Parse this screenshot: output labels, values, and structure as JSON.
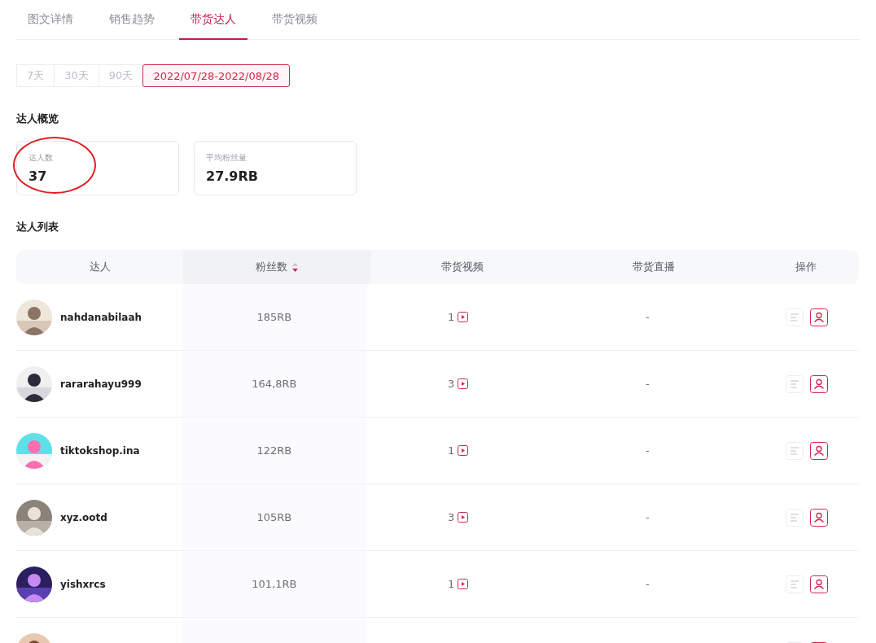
{
  "tabs": [
    {
      "label": "图文详情",
      "selected": false
    },
    {
      "label": "销售趋势",
      "selected": false
    },
    {
      "label": "带货达人",
      "selected": true
    },
    {
      "label": "带货视频",
      "selected": false
    }
  ],
  "date_ranges": [
    {
      "label": "7天",
      "selected": false
    },
    {
      "label": "30天",
      "selected": false
    },
    {
      "label": "90天",
      "selected": false
    },
    {
      "label": "2022/07/28-2022/08/28",
      "selected": true
    }
  ],
  "overview": {
    "title": "达人概览",
    "cards": [
      {
        "label": "达人数",
        "value": "37",
        "circled": true
      },
      {
        "label": "平均粉丝量",
        "value": "27.9RB",
        "circled": false
      }
    ]
  },
  "list": {
    "title": "达人列表",
    "columns": [
      {
        "label": "达人",
        "sorted": false
      },
      {
        "label": "粉丝数",
        "sorted": true
      },
      {
        "label": "带货视频",
        "sorted": false
      },
      {
        "label": "带货直播",
        "sorted": false
      },
      {
        "label": "操作",
        "sorted": false
      }
    ],
    "rows": [
      {
        "kind": "creator",
        "name": "nahdanabilaah",
        "fans": "185RB",
        "videos": "1",
        "live": "-"
      },
      {
        "kind": "creator",
        "name": "rararahayu999",
        "fans": "164,8RB",
        "videos": "3",
        "live": "-"
      },
      {
        "kind": "creator",
        "name": "tiktokshop.ina",
        "fans": "122RB",
        "videos": "1",
        "live": "-"
      },
      {
        "kind": "creator",
        "name": "xyz.ootd",
        "fans": "105RB",
        "videos": "3",
        "live": "-"
      },
      {
        "kind": "creator",
        "name": "yishxrcs",
        "fans": "101,1RB",
        "videos": "1",
        "live": "-"
      },
      {
        "kind": "cut_off"
      }
    ]
  }
}
